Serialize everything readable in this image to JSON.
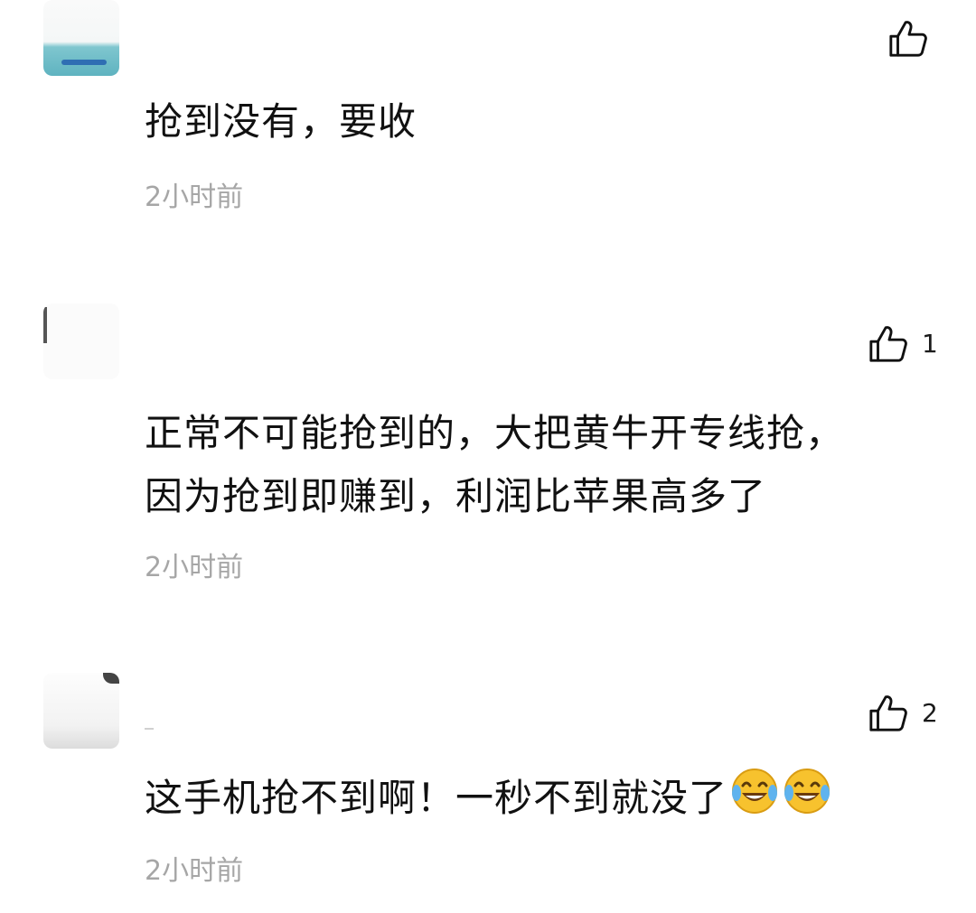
{
  "comments": [
    {
      "text": "抢到没有，要收",
      "time": "2小时前",
      "likes": ""
    },
    {
      "text_line1": "正常不可能抢到的，大把黄牛开专线抢，",
      "text_line2": "因为抢到即赚到，利润比苹果高多了",
      "time": "2小时前",
      "likes": "1"
    },
    {
      "text": "这手机抢不到啊！一秒不到就没了",
      "time": "2小时前",
      "likes": "2",
      "emojis": [
        "😂",
        "😂"
      ]
    }
  ],
  "icons": {
    "like": "thumbs-up-icon",
    "emoji": "laughing-crying-emoji"
  }
}
